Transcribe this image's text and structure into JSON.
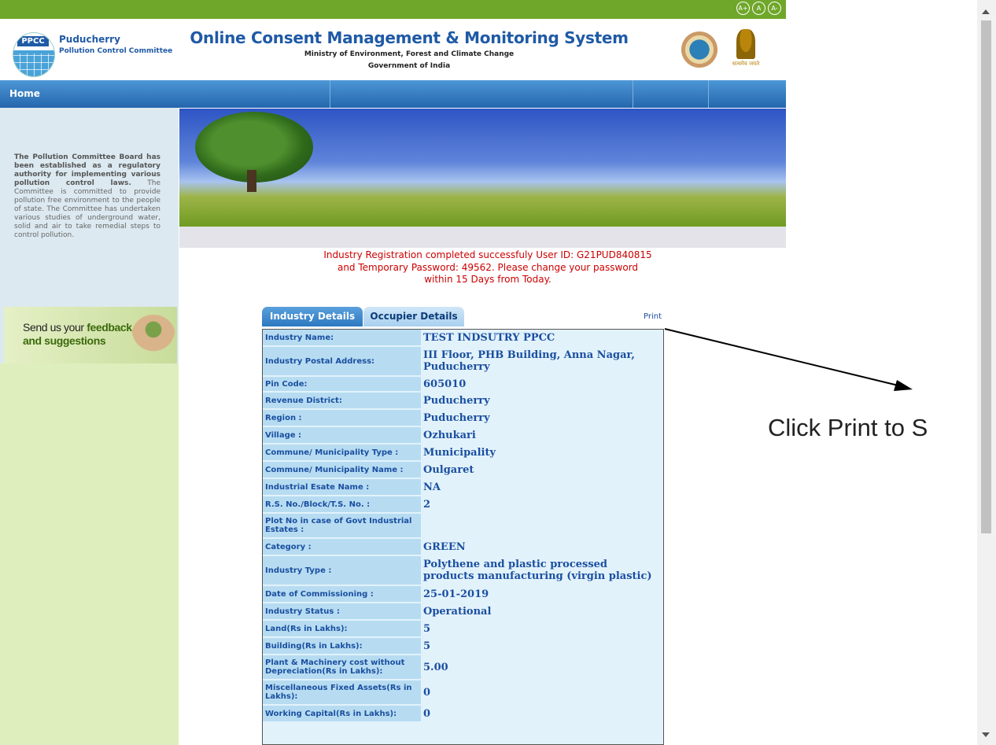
{
  "font_controls": [
    "A+",
    "A",
    "A-"
  ],
  "brand": {
    "logo_text": "PPCC",
    "org_name": "Puducherry",
    "org_subtitle": "Pollution Control Committee"
  },
  "header": {
    "title": "Online Consent Management & Monitoring System",
    "subtitle1": "Ministry of Environment, Forest and Climate Change",
    "subtitle2": "Government of India",
    "emblem_motto": "सत्यमेव जयते"
  },
  "nav": {
    "home_label": "Home"
  },
  "sidebar": {
    "intro_bold": "The Pollution Committee Board has been established as a regulatory authority for implementing various pollution control laws.",
    "intro_rest": "The Committee is committed to provide pollution free environment to the people of state. The Committee has undertaken various studies of underground water, solid and air to take remedial steps to control pollution.",
    "feedback_line1_prefix": "Send us your ",
    "feedback_line1_bold": "feedback",
    "feedback_line2": "and suggestions"
  },
  "message": "Industry Registration completed successfuly User ID: G21PUD840815 and Temporary Password: 49562. Please change your password within 15 Days from Today.",
  "tabs": [
    {
      "label": "Industry Details",
      "active": true
    },
    {
      "label": "Occupier Details",
      "active": false
    }
  ],
  "print_label": "Print",
  "details": [
    {
      "key": "Industry Name:",
      "value": "TEST INDSUTRY PPCC"
    },
    {
      "key": "Industry Postal Address:",
      "value": "III Floor, PHB Building, Anna Nagar, Puducherry"
    },
    {
      "key": "Pin Code:",
      "value": "605010"
    },
    {
      "key": "Revenue District:",
      "value": "Puducherry"
    },
    {
      "key": "Region :",
      "value": "Puducherry"
    },
    {
      "key": "Village :",
      "value": "Ozhukari"
    },
    {
      "key": "Commune/ Municipality Type :",
      "value": "Municipality"
    },
    {
      "key": "Commune/ Municipality Name :",
      "value": "Oulgaret"
    },
    {
      "key": "Industrial Esate Name :",
      "value": "NA"
    },
    {
      "key": "R.S. No./Block/T.S. No. :",
      "value": "2"
    },
    {
      "key": "Plot No in case of Govt Industrial Estates :",
      "value": ""
    },
    {
      "key": "Category :",
      "value": "GREEN"
    },
    {
      "key": "Industry Type :",
      "value": "Polythene and plastic processed products manufacturing (virgin plastic)"
    },
    {
      "key": "Date of Commissioning :",
      "value": "25-01-2019"
    },
    {
      "key": "Industry Status :",
      "value": "Operational"
    },
    {
      "key": "Land(Rs in Lakhs):",
      "value": "5"
    },
    {
      "key": "Building(Rs in Lakhs):",
      "value": "5"
    },
    {
      "key": "Plant & Machinery cost without Depreciation(Rs in Lakhs):",
      "value": "5.00"
    },
    {
      "key": "Miscellaneous Fixed Assets(Rs in Lakhs):",
      "value": "0"
    },
    {
      "key": "Working Capital(Rs in Lakhs):",
      "value": "0"
    }
  ],
  "callout": "Click Print to S"
}
